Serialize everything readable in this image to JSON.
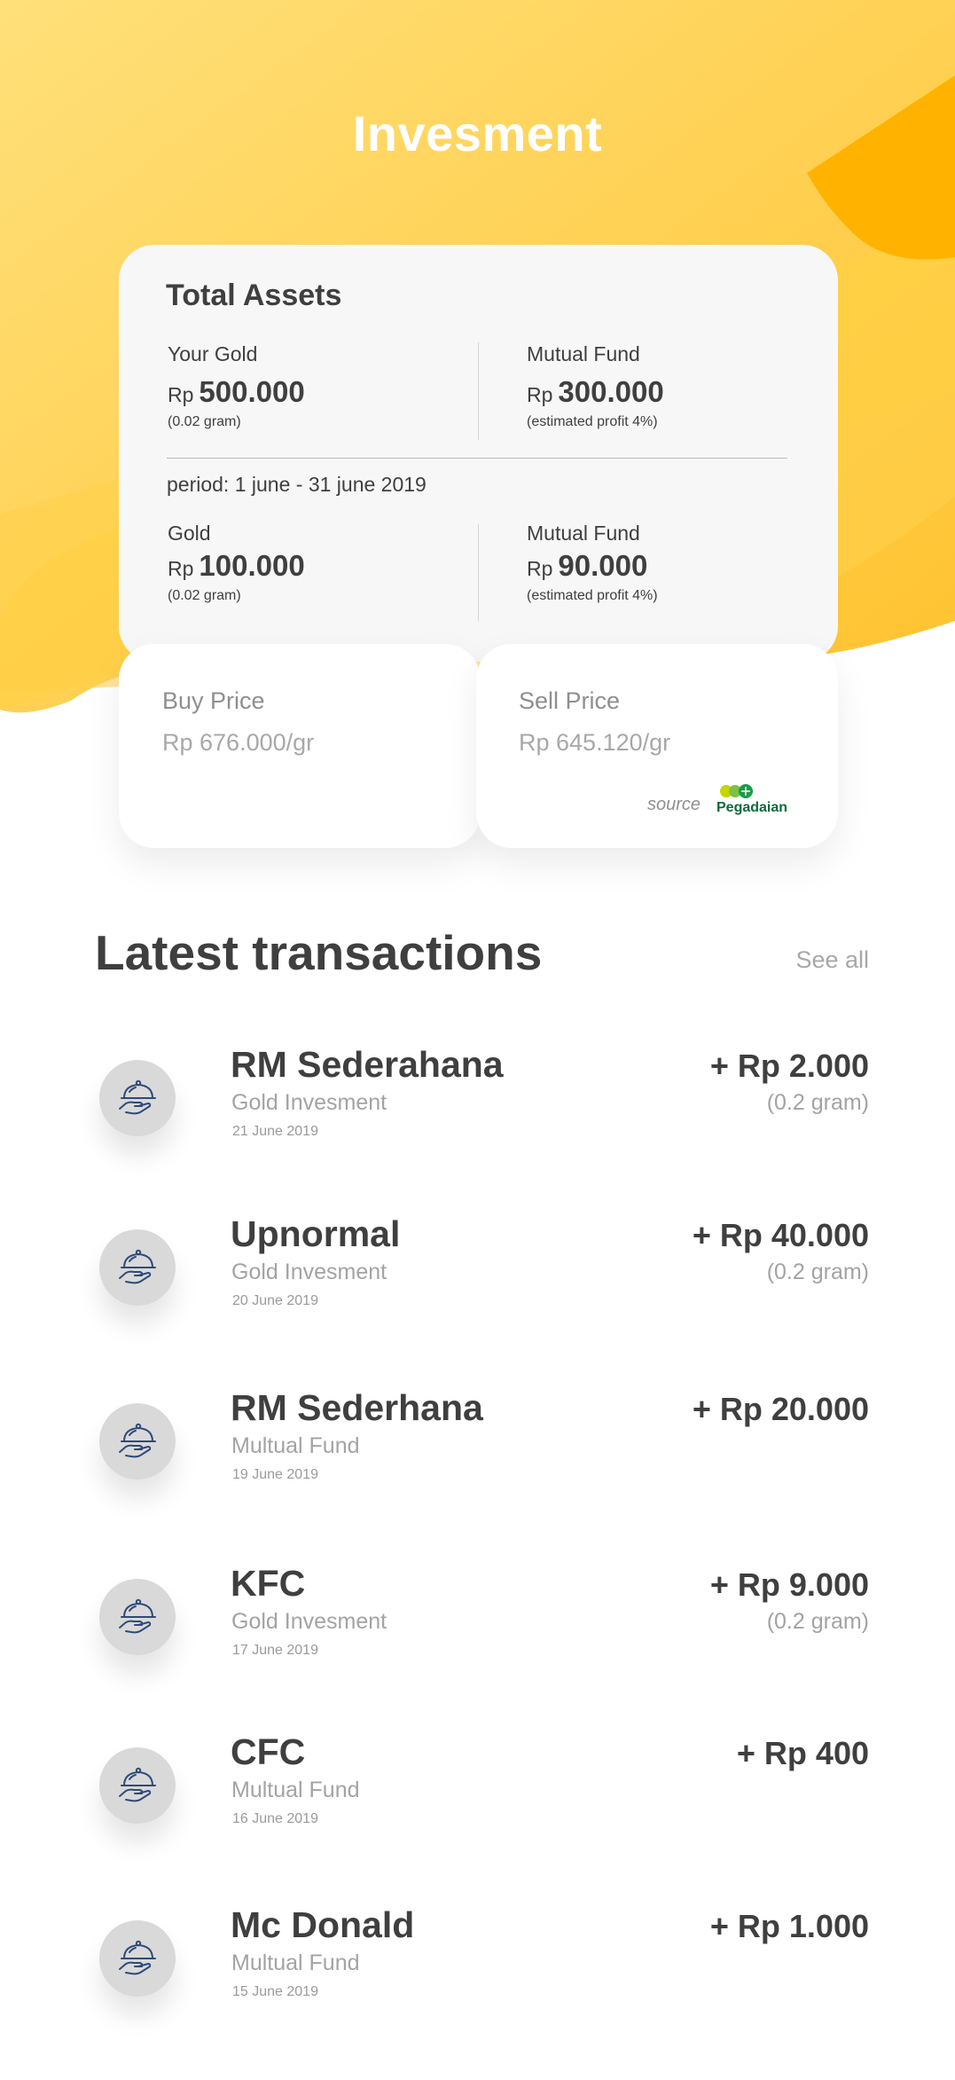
{
  "header": {
    "title": "Invesment"
  },
  "assets": {
    "title": "Total Assets",
    "your_gold": {
      "label": "Your Gold",
      "currency": "Rp",
      "value": "500.000",
      "note": "(0.02 gram)"
    },
    "mutual_fund": {
      "label": "Mutual Fund",
      "currency": "Rp",
      "value": "300.000",
      "note": "(estimated profit 4%)"
    },
    "period": "period: 1 june - 31 june 2019",
    "period_gold": {
      "label": "Gold",
      "currency": "Rp",
      "value": "100.000",
      "note": "(0.02 gram)"
    },
    "period_mutual_fund": {
      "label": "Mutual Fund",
      "currency": "Rp",
      "value": "90.000",
      "note": "(estimated profit 4%)"
    }
  },
  "prices": {
    "buy": {
      "label": "Buy Price",
      "value": "Rp 676.000/gr"
    },
    "sell": {
      "label": "Sell Price",
      "value": "Rp 645.120/gr"
    },
    "source_label": "source",
    "source_brand": "Pegadaian"
  },
  "transactions": {
    "title": "Latest transactions",
    "see_all": "See all",
    "items": [
      {
        "name": "RM Sederahana",
        "category": "Gold Invesment",
        "date": "21 June 2019",
        "amount": "+ Rp 2.000",
        "weight": "(0.2 gram)",
        "icon": "food-tray-icon"
      },
      {
        "name": "Upnormal",
        "category": "Gold Invesment",
        "date": "20 June 2019",
        "amount": "+ Rp 40.000",
        "weight": "(0.2 gram)",
        "icon": "food-tray-icon"
      },
      {
        "name": "RM Sederhana",
        "category": "Multual Fund",
        "date": "19 June 2019",
        "amount": "+ Rp 20.000",
        "weight": "",
        "icon": "food-tray-icon"
      },
      {
        "name": "KFC",
        "category": "Gold Invesment",
        "date": "17 June 2019",
        "amount": "+ Rp 9.000",
        "weight": "(0.2 gram)",
        "icon": "food-tray-icon"
      },
      {
        "name": "CFC",
        "category": "Multual Fund",
        "date": "16 June 2019",
        "amount": "+ Rp 400",
        "weight": "",
        "icon": "food-tray-icon"
      },
      {
        "name": "Mc Donald",
        "category": "Multual Fund",
        "date": "15 June 2019",
        "amount": "+ Rp 1.000",
        "weight": "",
        "icon": "food-tray-icon"
      }
    ]
  },
  "colors": {
    "accent_yellow": "#ffc93c",
    "accent_orange": "#ffb300",
    "text_dark": "#3f3f3f",
    "text_muted": "#a3a3a3",
    "brand_green": "#0b6b3a"
  }
}
